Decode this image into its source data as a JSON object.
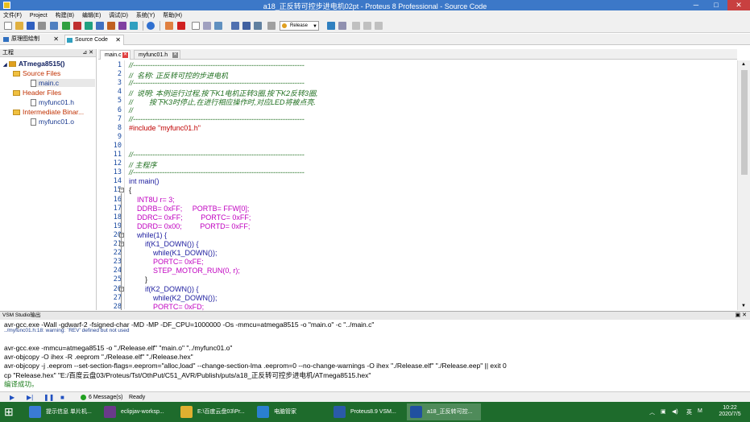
{
  "window": {
    "title": "a18_正反转可控步进电机02pt - Proteus 8 Professional - Source Code",
    "minimize": "─",
    "maximize": "□",
    "close": "✕"
  },
  "menu": [
    "文件(F)",
    "Project",
    "构建(B)",
    "编辑(E)",
    "调试(D)",
    "系统(Y)",
    "帮助(H)"
  ],
  "toolbar": {
    "build_config": "Release",
    "arrow": "▼"
  },
  "doc_tabs": [
    {
      "label": "原理图绘制",
      "close": "✕"
    },
    {
      "label": "Source Code",
      "close": "✕"
    }
  ],
  "project_panel": {
    "title": "工程",
    "pin": "⊿ ✕",
    "root": "ATmega8515()",
    "groups": [
      {
        "label": "Source Files",
        "files": [
          "main.c"
        ]
      },
      {
        "label": "Header Files",
        "files": [
          "myfunc01.h"
        ]
      },
      {
        "label": "Intermediate Binar...",
        "files": [
          "myfunc01.o"
        ]
      }
    ]
  },
  "editor": {
    "tabs": [
      {
        "label": "main.c",
        "close": "✕"
      },
      {
        "label": "myfunc01.h",
        "close": "✕"
      }
    ],
    "lines": [
      {
        "n": "1",
        "t": "//-----------------------------------------------------------------------"
      },
      {
        "n": "2",
        "t": "//  名称: 正反转可控的步进电机"
      },
      {
        "n": "3",
        "t": "//-----------------------------------------------------------------------"
      },
      {
        "n": "4",
        "t": "//  说明: 本例运行过程,按下K1电机正转3圈,按下K2反转3圈,"
      },
      {
        "n": "5",
        "t": "//        按下K3时停止,在进行相应操作时,对应LED将被点亮."
      },
      {
        "n": "6",
        "t": "//"
      },
      {
        "n": "7",
        "t": "//-----------------------------------------------------------------------"
      },
      {
        "n": "8",
        "t": "#include \"myfunc01.h\""
      },
      {
        "n": "9",
        "t": ""
      },
      {
        "n": "10",
        "t": ""
      },
      {
        "n": "11",
        "t": "//-----------------------------------------------------------------------"
      },
      {
        "n": "12",
        "t": "// 主程序"
      },
      {
        "n": "13",
        "t": "//-----------------------------------------------------------------------"
      },
      {
        "n": "14",
        "t": "int main()"
      },
      {
        "n": "15",
        "t": "{"
      },
      {
        "n": "16",
        "t": "    INT8U r= 3;"
      },
      {
        "n": "17",
        "t": "    DDRB= 0xFF;     PORTB= FFW[0];"
      },
      {
        "n": "18",
        "t": "    DDRC= 0xFF;         PORTC= 0xFF;"
      },
      {
        "n": "19",
        "t": "    DDRD= 0x00;         PORTD= 0xFF;"
      },
      {
        "n": "20",
        "t": "    while(1) {"
      },
      {
        "n": "21",
        "t": "        if(K1_DOWN()) {"
      },
      {
        "n": "22",
        "t": "            while(K1_DOWN());"
      },
      {
        "n": "23",
        "t": "            PORTC= 0xFE;"
      },
      {
        "n": "24",
        "t": "            STEP_MOTOR_RUN(0, r);"
      },
      {
        "n": "25",
        "t": "        }"
      },
      {
        "n": "26",
        "t": "        if(K2_DOWN()) {"
      },
      {
        "n": "27",
        "t": "            while(K2_DOWN());"
      },
      {
        "n": "28",
        "t": "            PORTC= 0xFD;"
      }
    ]
  },
  "output": {
    "title": "VSM Studio输出",
    "buttons": "▣ ✕",
    "lines": [
      {
        "t": "avr-gcc.exe -Wall -gdwarf-2 -fsigned-char -MD -MP -DF_CPU=1000000 -Os -mmcu=atmega8515  -o \"main.o\" -c \"../main.c\"",
        "k": "normal"
      },
      {
        "t": "../myfunc01.h:18: warning: `REV' defined but not used",
        "k": "warn"
      },
      {
        "t": "avr-gcc.exe -mmcu=atmega8515  -o \"./Release.elf\" \"main.o\" \"../myfunc01.o\"",
        "k": "normal"
      },
      {
        "t": "avr-objcopy -O ihex -R .eeprom \"./Release.elf\" \"./Release.hex\"",
        "k": "normal"
      },
      {
        "t": "avr-objcopy -j .eeprom --set-section-flags=.eeprom=\"alloc,load\" --change-section-lma .eeprom=0 --no-change-warnings -O ihex \"./Release.elf\" \"./Release.eep\" || exit 0",
        "k": "normal"
      },
      {
        "t": "cp \"Release.hex\" \"E:/百度云盘03/Proteus/Tst/OthPut/C51_AVR/Publish/puts/a18_正反转可控步进电机/ATmega8515.hex\"",
        "k": "normal"
      },
      {
        "t": "编译成功。",
        "k": "ok"
      }
    ]
  },
  "status": {
    "play": "▶",
    "step": "▶|",
    "pause": "❚❚",
    "stop": "■",
    "messages": "6 Message(s)",
    "state": "Ready"
  },
  "taskbar": {
    "start": "⊞",
    "items": [
      {
        "label": "提示信息 单片机...",
        "color": "#3a7bd5"
      },
      {
        "label": "eclipjav-worksp...",
        "color": "#6a3a8a"
      },
      {
        "label": "E:\\百度云盘03\\Pr...",
        "color": "#e0b030"
      },
      {
        "label": "电脑管家",
        "color": "#2a80d0"
      },
      {
        "label": "Proteus8.9 VSM...",
        "color": "#2a5aa8"
      },
      {
        "label": "a18_正反转可控...",
        "color": "#2050a0"
      }
    ],
    "ime": "英",
    "lang": "M",
    "time": "10:22",
    "date": "2020/7/5"
  }
}
